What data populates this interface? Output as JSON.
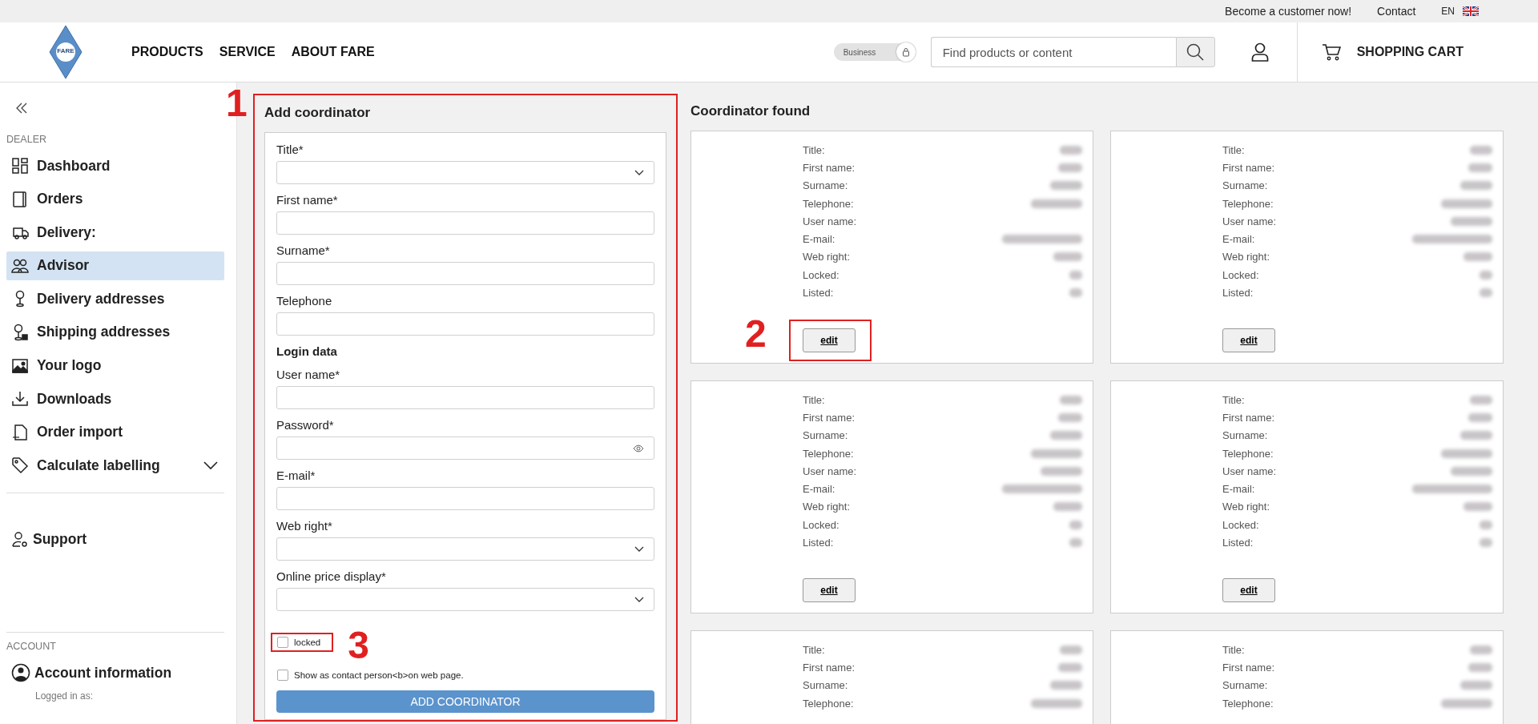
{
  "top_bar": {
    "links": [
      "Become a customer now!",
      "Contact"
    ],
    "language": "EN"
  },
  "header": {
    "logo": "FARE",
    "nav": [
      "PRODUCTS",
      "SERVICE",
      "ABOUT FARE"
    ],
    "toggle": {
      "label": "Business"
    },
    "search": {
      "placeholder": "Find products or content"
    },
    "cart": "SHOPPING CART"
  },
  "sidebar": {
    "dealer": {
      "heading": "DEALER",
      "items": [
        {
          "label": "Dashboard",
          "selected": false
        },
        {
          "label": "Orders",
          "selected": false
        },
        {
          "label": "Delivery:",
          "selected": false
        },
        {
          "label": "Advisor",
          "selected": true
        },
        {
          "label": "Delivery addresses",
          "selected": false
        },
        {
          "label": "Shipping addresses",
          "selected": false
        },
        {
          "label": "Your logo",
          "selected": false
        },
        {
          "label": "Downloads",
          "selected": false
        },
        {
          "label": "Order import",
          "selected": false
        },
        {
          "label": "Calculate labelling",
          "selected": false,
          "expanded": false
        }
      ]
    },
    "support": "Support",
    "account": {
      "heading": "ACCOUNT",
      "item": "Account information",
      "note": "Logged in as:"
    }
  },
  "form": {
    "title": "Add coordinator",
    "callout": "1",
    "fields": [
      {
        "kind": "select",
        "label": "Title*"
      },
      {
        "kind": "text",
        "label": "First name*"
      },
      {
        "kind": "text",
        "label": "Surname*"
      },
      {
        "kind": "text",
        "label": "Telephone"
      },
      {
        "kind": "heading",
        "label": "Login data"
      },
      {
        "kind": "text",
        "label": "User name*"
      },
      {
        "kind": "password",
        "label": "Password*"
      },
      {
        "kind": "text",
        "label": "E-mail*"
      },
      {
        "kind": "select",
        "label": "Web right*"
      },
      {
        "kind": "select",
        "label": "Online price display*"
      }
    ],
    "checkboxes": [
      {
        "label": "locked",
        "checked": false,
        "callout": "3"
      },
      {
        "label": "Show as contact person<b>on web page.",
        "checked": false
      }
    ],
    "button": "ADD COORDINATOR"
  },
  "results": {
    "title": "Coordinator found",
    "cards": [
      {
        "callout": "2",
        "button": "edit",
        "fields": [
          {
            "label": "Title:",
            "blurred": true
          },
          {
            "label": "First name:",
            "blurred": true
          },
          {
            "label": "Surname:",
            "blurred": true
          },
          {
            "label": "Telephone:",
            "blurred": true
          },
          {
            "label": "User name:",
            "blurred": false
          },
          {
            "label": "E-mail:",
            "blurred": true
          },
          {
            "label": "Web right:",
            "blurred": true
          },
          {
            "label": "Locked:",
            "blurred": true
          },
          {
            "label": "Listed:",
            "blurred": true
          }
        ]
      },
      {
        "button": "edit",
        "fields": [
          {
            "label": "Title:",
            "blurred": true
          },
          {
            "label": "First name:",
            "blurred": true
          },
          {
            "label": "Surname:",
            "blurred": true
          },
          {
            "label": "Telephone:",
            "blurred": true
          },
          {
            "label": "User name:",
            "blurred": true
          },
          {
            "label": "E-mail:",
            "blurred": true
          },
          {
            "label": "Web right:",
            "blurred": true
          },
          {
            "label": "Locked:",
            "blurred": true
          },
          {
            "label": "Listed:",
            "blurred": true
          }
        ]
      },
      {
        "button": "edit",
        "fields": [
          {
            "label": "Title:",
            "blurred": true
          },
          {
            "label": "First name:",
            "blurred": true
          },
          {
            "label": "Surname:",
            "blurred": true
          },
          {
            "label": "Telephone:",
            "blurred": true
          },
          {
            "label": "User name:",
            "blurred": true
          },
          {
            "label": "E-mail:",
            "blurred": true
          },
          {
            "label": "Web right:",
            "blurred": true
          },
          {
            "label": "Locked:",
            "blurred": true
          },
          {
            "label": "Listed:",
            "blurred": true
          }
        ]
      },
      {
        "button": "edit",
        "fields": [
          {
            "label": "Title:",
            "blurred": true
          },
          {
            "label": "First name:",
            "blurred": true
          },
          {
            "label": "Surname:",
            "blurred": true
          },
          {
            "label": "Telephone:",
            "blurred": true
          },
          {
            "label": "User name:",
            "blurred": true
          },
          {
            "label": "E-mail:",
            "blurred": true
          },
          {
            "label": "Web right:",
            "blurred": true
          },
          {
            "label": "Locked:",
            "blurred": true
          },
          {
            "label": "Listed:",
            "blurred": true
          }
        ]
      },
      {
        "fields": [
          {
            "label": "Title:",
            "blurred": true
          },
          {
            "label": "First name:",
            "blurred": true
          },
          {
            "label": "Surname:",
            "blurred": true
          },
          {
            "label": "Telephone:",
            "blurred": true
          }
        ]
      },
      {
        "fields": [
          {
            "label": "Title:",
            "blurred": true
          },
          {
            "label": "First name:",
            "blurred": true
          },
          {
            "label": "Surname:",
            "blurred": true
          },
          {
            "label": "Telephone:",
            "blurred": true
          }
        ]
      }
    ]
  }
}
